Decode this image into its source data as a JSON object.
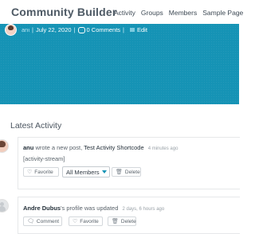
{
  "header": {
    "site_title": "Community Builder",
    "nav": [
      "Activity",
      "Groups",
      "Members",
      "Sample Page"
    ]
  },
  "post_meta": {
    "author": "anu",
    "date": "July 22, 2020",
    "comments": "0 Comments",
    "edit_label": "Edit"
  },
  "section_title": "Latest Activity",
  "activities": [
    {
      "author": "anu",
      "action": "wrote a new post,",
      "object": "Test Activity Shortcode",
      "time": "4 minutes ago",
      "content": "[activity-stream]",
      "favorite_label": "Favorite",
      "visibility_label": "All Members",
      "delete_label": "Delete"
    },
    {
      "author": "Andre Dubus",
      "action": "'s profile was updated",
      "time": "2 days, 6 hours ago",
      "comment_label": "Comment",
      "favorite_label": "Favorite",
      "delete_label": "Delete"
    }
  ],
  "colors": {
    "hero": "#1593b5",
    "accent": "#1593b5"
  }
}
